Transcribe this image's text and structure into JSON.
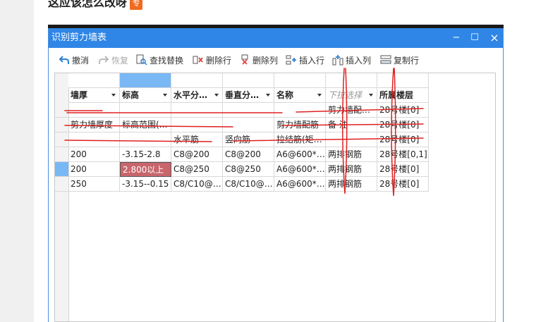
{
  "page": {
    "question": "这应该怎么改呀",
    "badge": "专"
  },
  "window": {
    "title": "识别剪力墙表",
    "minimize": "−",
    "maximize": "☐",
    "close": "×"
  },
  "toolbar": {
    "undo": "撤消",
    "redo": "恢复",
    "find_replace": "查找替换",
    "delete_row": "删除行",
    "delete_col": "删除列",
    "insert_row": "插入行",
    "insert_col": "插入列",
    "copy_row": "复制行"
  },
  "table": {
    "headers": [
      "墙厚",
      "标高",
      "水平分…",
      "垂直分…",
      "名称",
      "下拉选择",
      "所属楼层"
    ],
    "rows": [
      [
        "",
        "",
        "",
        "",
        "",
        "剪力墙配…",
        "28号楼[0]"
      ],
      [
        "剪力墙厚度",
        "标高范围(…",
        "",
        "",
        "剪力墙配筋",
        "备 注",
        "28号楼[0]"
      ],
      [
        "",
        "",
        "水平筋",
        "竖向筋",
        "拉结筋(矩…",
        "",
        "28号楼[0]"
      ],
      [
        "200",
        "-3.15-2.8",
        "C8@200",
        "C8@200",
        "A6@600*…",
        "两排钢筋",
        "28号楼[0,1]"
      ],
      [
        "200",
        "2.800以上",
        "C8@250",
        "C8@250",
        "A6@600*…",
        "两排钢筋",
        "28号楼[0]"
      ],
      [
        "250",
        "-3.15--0.15",
        "C8/C10@…",
        "C8/C10@…",
        "A6@600*…",
        "两排钢筋",
        "28号楼[0]"
      ]
    ]
  },
  "colors": {
    "titlebar": "#2f86e6",
    "selected_header": "#7ab8f5",
    "highlight_cell": "#c9666c",
    "annotation": "#e02020"
  }
}
